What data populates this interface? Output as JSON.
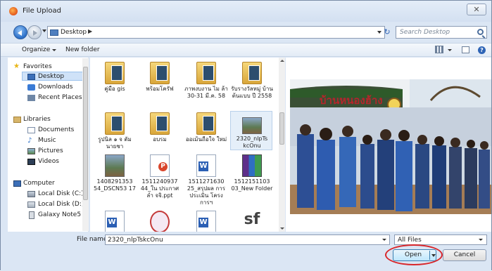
{
  "window": {
    "title": "File Upload",
    "close_glyph": "✕"
  },
  "address": {
    "path": "Desktop",
    "separator": "▶",
    "refresh_glyph": "↻",
    "search_placeholder": "Search Desktop"
  },
  "toolbar": {
    "organize": "Organize",
    "new_folder": "New folder",
    "help_glyph": "?"
  },
  "nav": {
    "favorites": {
      "label": "Favorites",
      "items": [
        "Desktop",
        "Downloads",
        "Recent Places"
      ]
    },
    "libraries": {
      "label": "Libraries",
      "items": [
        "Documents",
        "Music",
        "Pictures",
        "Videos"
      ]
    },
    "computer": {
      "label": "Computer",
      "items": [
        "Local Disk (C:)",
        "Local Disk (D:)",
        "Galaxy Note5"
      ]
    }
  },
  "files": [
    {
      "name": "คู่มือ gis",
      "type": "folder"
    },
    {
      "name": "พร้อมโครัฟ",
      "type": "folder"
    },
    {
      "name": "ภาพงบงาน ไม ล้า 30-31 มี.ค. 58",
      "type": "folder"
    },
    {
      "name": "รับรางวัลหมู่ บ้านต้นแบบ ปี 2558",
      "type": "folder"
    },
    {
      "name": "รูปนิล ๑ จ ตัม นายชา",
      "type": "folder"
    },
    {
      "name": "อบรม",
      "type": "folder"
    },
    {
      "name": "ออเม้นถือใจ ใหม่",
      "type": "folder"
    },
    {
      "name": "2320_nlpTs kcOnu",
      "type": "photo"
    },
    {
      "name": "1408291353 54_DSCN53 17",
      "type": "photo"
    },
    {
      "name": "1511240937 44_ใน ประกาศ ลำ จจิ.ppt",
      "type": "ppt"
    },
    {
      "name": "1511271630 25_สรุปผล การประเมิน โครงการฯ",
      "type": "word"
    },
    {
      "name": "1512151103 03_New Folder",
      "type": "rar"
    },
    {
      "name": "",
      "type": "word"
    },
    {
      "name": "",
      "type": "other"
    },
    {
      "name": "",
      "type": "word"
    },
    {
      "name": "sf",
      "type": "text"
    }
  ],
  "bottom": {
    "filename_label": "File name:",
    "filename_value": "2320_nlpTskcOnu",
    "filter_value": "All Files",
    "open_label": "Open",
    "cancel_label": "Cancel"
  },
  "preview": {
    "banner_text": "บ้านหนองฮ้าง"
  },
  "colors": {
    "accent": "#2b6fc8",
    "highlight_ring": "#d9262a",
    "window_bg": "#dbe6f4"
  }
}
